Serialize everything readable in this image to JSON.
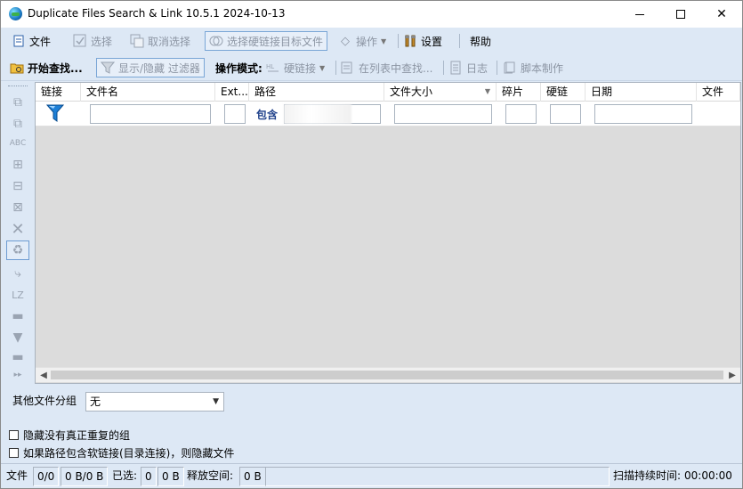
{
  "window": {
    "title": "Duplicate Files Search & Link 10.5.1 2024-10-13"
  },
  "toolbar1": {
    "file": "文件",
    "select": "选择",
    "deselect": "取消选择",
    "select_hardlink_target": "选择硬链接目标文件",
    "operation": "操作",
    "settings": "设置",
    "help": "帮助"
  },
  "toolbar2": {
    "start_search": "开始查找...",
    "toggle_filter": "显示/隐藏 过滤器",
    "mode_label": "操作模式:",
    "hardlink": "硬链接",
    "find_in_list": "在列表中查找...",
    "log": "日志",
    "script": "脚本制作"
  },
  "grid": {
    "columns": [
      "链接",
      "文件名",
      "Ext...",
      "路径",
      "文件大小",
      "碎片",
      "硬链",
      "日期",
      "文件"
    ],
    "path_filter_label": "包含",
    "filters": {
      "filename": "",
      "ext": "",
      "path": "",
      "size": "",
      "fragments": "",
      "hardlinks": "",
      "date": ""
    }
  },
  "panel": {
    "other_group_label": "其他文件分组",
    "other_group_value": "无",
    "hide_no_dup_groups": "隐藏没有真正重复的组",
    "hide_soft_link_paths": "如果路径包含软链接(目录连接)，则隐藏文件"
  },
  "statusbar": {
    "files_label": "文件",
    "files_count": "0/0",
    "files_size": "0 B/0 B",
    "selected_label": "已选:",
    "selected_count": "0",
    "selected_size": "0 B",
    "free_space_label": "释放空间:",
    "free_space": "0 B",
    "scan_time_label": "扫描持续时间:",
    "scan_time": "00:00:00"
  },
  "colors": {
    "accent": "#1d3f8a",
    "toolbar_bg": "#dde8f5",
    "grid_bg": "#dcdcdc"
  }
}
